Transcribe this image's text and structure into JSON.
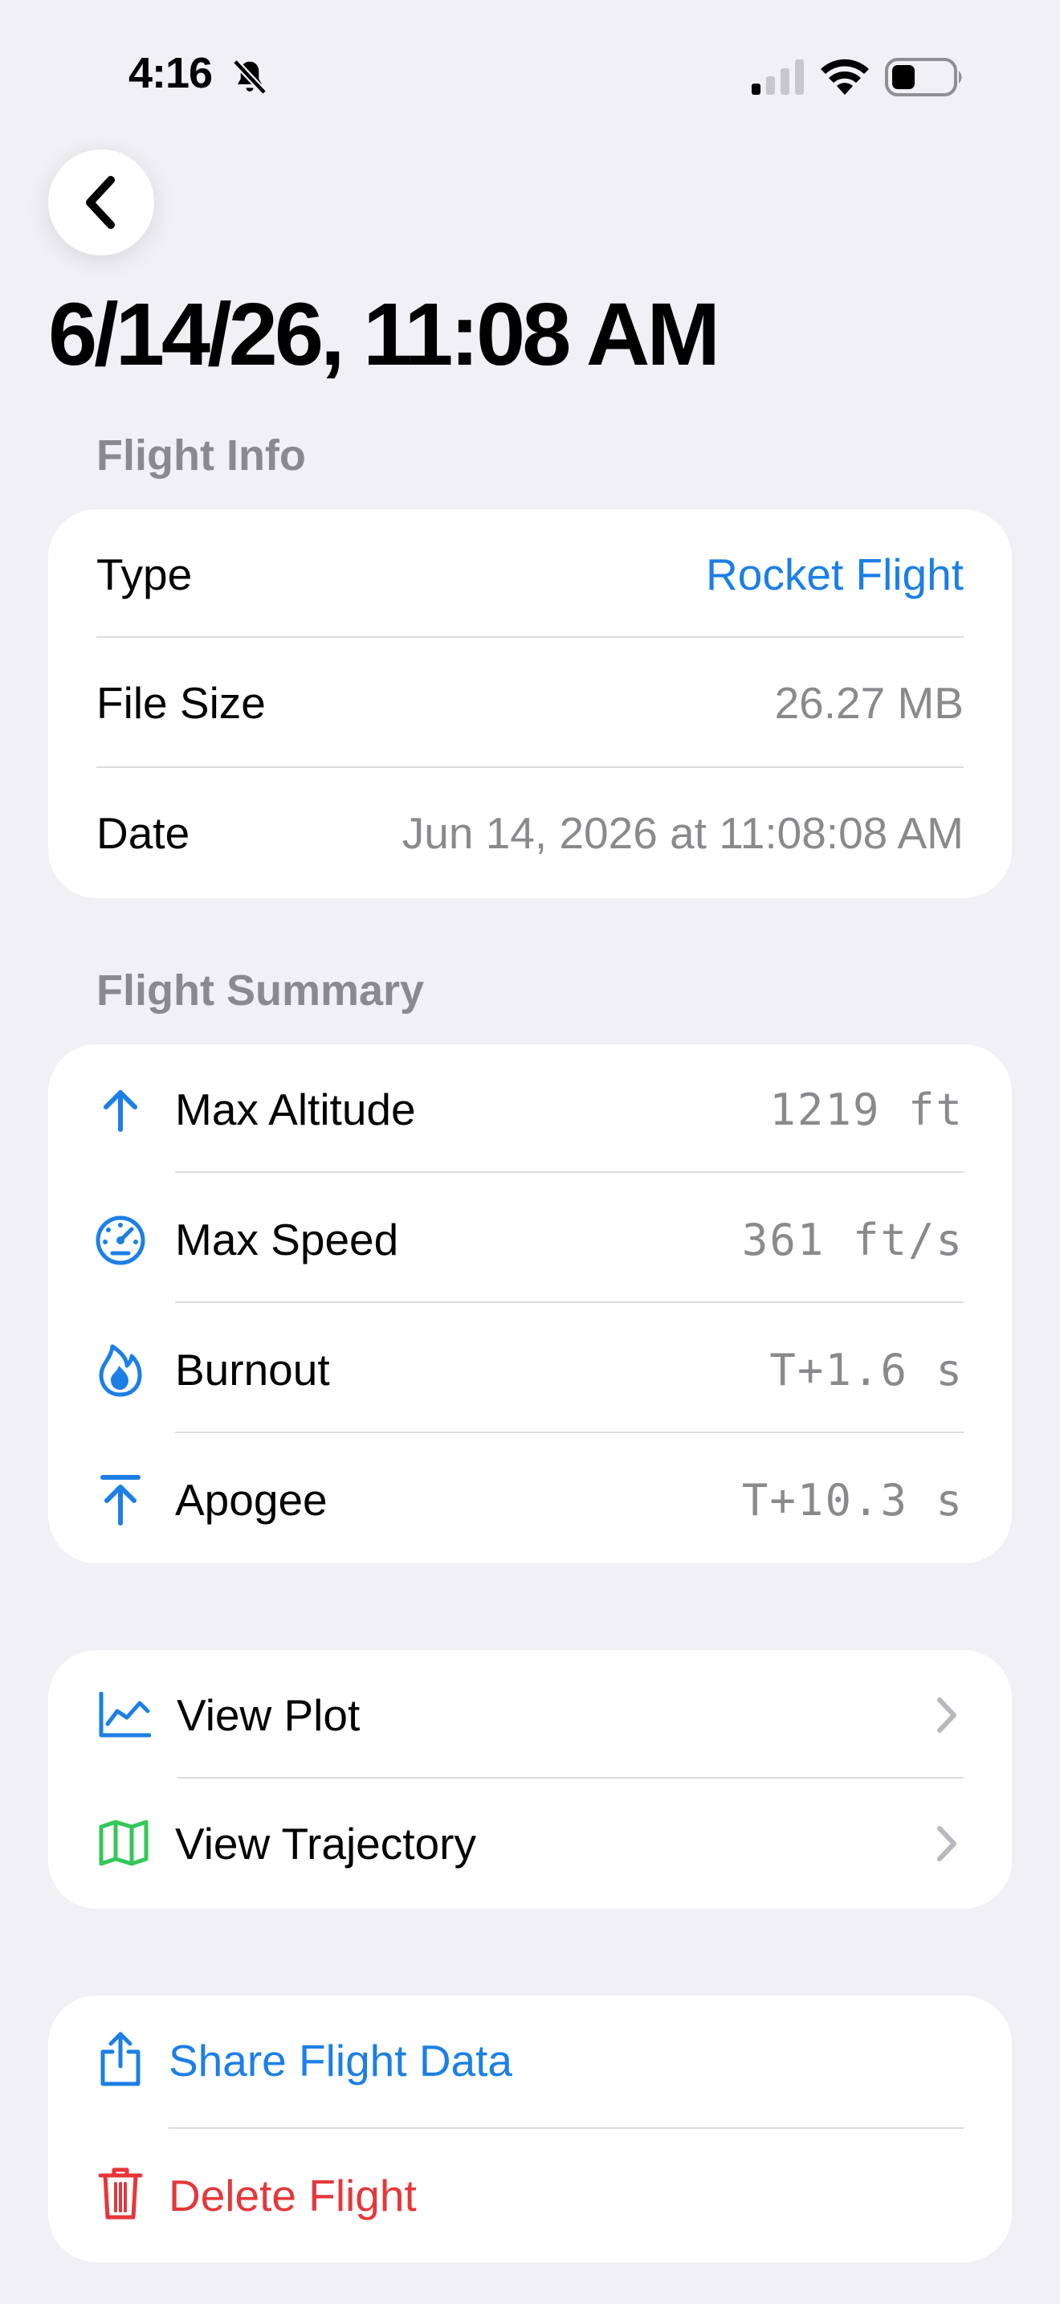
{
  "status_bar": {
    "time": "4:16",
    "icons": [
      "bell-slash-icon",
      "cellular-signal-icon",
      "wifi-icon",
      "battery-icon"
    ]
  },
  "nav": {
    "back_icon": "chevron-left-icon"
  },
  "title": "6/14/26, 11:08 AM",
  "flight_info": {
    "section_label": "Flight Info",
    "rows": [
      {
        "label": "Type",
        "value": "Rocket Flight"
      },
      {
        "label": "File Size",
        "value": "26.27 MB"
      },
      {
        "label": "Date",
        "value": "Jun 14, 2026 at 11:08:08 AM"
      }
    ]
  },
  "flight_summary": {
    "section_label": "Flight Summary",
    "rows": [
      {
        "icon": "arrow-up-icon",
        "label": "Max Altitude",
        "value": "1219 ft"
      },
      {
        "icon": "speedometer-icon",
        "label": "Max Speed",
        "value": "361 ft/s"
      },
      {
        "icon": "flame-icon",
        "label": "Burnout",
        "value": "T+1.6 s"
      },
      {
        "icon": "arrow-up-to-line-icon",
        "label": "Apogee",
        "value": "T+10.3 s"
      }
    ]
  },
  "views": [
    {
      "icon": "line-chart-icon",
      "label": "View Plot"
    },
    {
      "icon": "map-icon",
      "label": "View Trajectory"
    }
  ],
  "actions": [
    {
      "icon": "share-icon",
      "label": "Share Flight Data"
    },
    {
      "icon": "trash-icon",
      "label": "Delete Flight"
    }
  ],
  "colors": {
    "background": "#f0f0f5",
    "accent_blue": "#1c7fe6",
    "destructive_red": "#e5373b",
    "map_green": "#34c759",
    "secondary_text": "#8a8a8e"
  }
}
